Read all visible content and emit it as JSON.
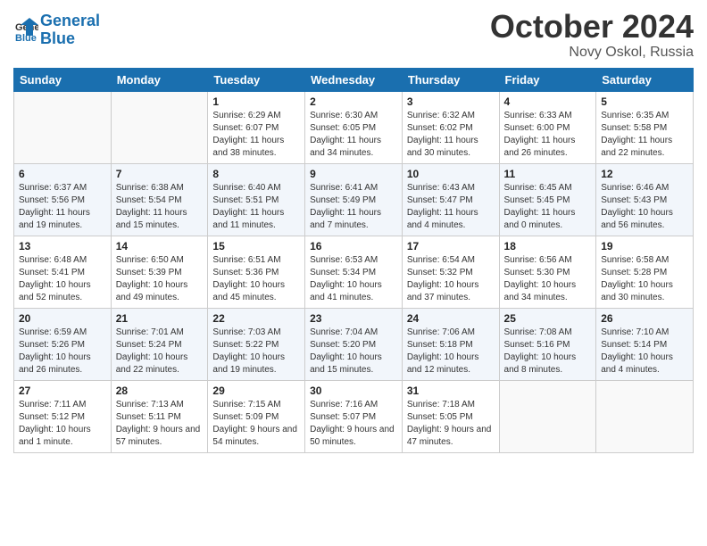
{
  "header": {
    "logo_line1": "General",
    "logo_line2": "Blue",
    "month": "October 2024",
    "location": "Novy Oskol, Russia"
  },
  "weekdays": [
    "Sunday",
    "Monday",
    "Tuesday",
    "Wednesday",
    "Thursday",
    "Friday",
    "Saturday"
  ],
  "weeks": [
    [
      {
        "day": "",
        "sunrise": "",
        "sunset": "",
        "daylight": ""
      },
      {
        "day": "",
        "sunrise": "",
        "sunset": "",
        "daylight": ""
      },
      {
        "day": "1",
        "sunrise": "Sunrise: 6:29 AM",
        "sunset": "Sunset: 6:07 PM",
        "daylight": "Daylight: 11 hours and 38 minutes."
      },
      {
        "day": "2",
        "sunrise": "Sunrise: 6:30 AM",
        "sunset": "Sunset: 6:05 PM",
        "daylight": "Daylight: 11 hours and 34 minutes."
      },
      {
        "day": "3",
        "sunrise": "Sunrise: 6:32 AM",
        "sunset": "Sunset: 6:02 PM",
        "daylight": "Daylight: 11 hours and 30 minutes."
      },
      {
        "day": "4",
        "sunrise": "Sunrise: 6:33 AM",
        "sunset": "Sunset: 6:00 PM",
        "daylight": "Daylight: 11 hours and 26 minutes."
      },
      {
        "day": "5",
        "sunrise": "Sunrise: 6:35 AM",
        "sunset": "Sunset: 5:58 PM",
        "daylight": "Daylight: 11 hours and 22 minutes."
      }
    ],
    [
      {
        "day": "6",
        "sunrise": "Sunrise: 6:37 AM",
        "sunset": "Sunset: 5:56 PM",
        "daylight": "Daylight: 11 hours and 19 minutes."
      },
      {
        "day": "7",
        "sunrise": "Sunrise: 6:38 AM",
        "sunset": "Sunset: 5:54 PM",
        "daylight": "Daylight: 11 hours and 15 minutes."
      },
      {
        "day": "8",
        "sunrise": "Sunrise: 6:40 AM",
        "sunset": "Sunset: 5:51 PM",
        "daylight": "Daylight: 11 hours and 11 minutes."
      },
      {
        "day": "9",
        "sunrise": "Sunrise: 6:41 AM",
        "sunset": "Sunset: 5:49 PM",
        "daylight": "Daylight: 11 hours and 7 minutes."
      },
      {
        "day": "10",
        "sunrise": "Sunrise: 6:43 AM",
        "sunset": "Sunset: 5:47 PM",
        "daylight": "Daylight: 11 hours and 4 minutes."
      },
      {
        "day": "11",
        "sunrise": "Sunrise: 6:45 AM",
        "sunset": "Sunset: 5:45 PM",
        "daylight": "Daylight: 11 hours and 0 minutes."
      },
      {
        "day": "12",
        "sunrise": "Sunrise: 6:46 AM",
        "sunset": "Sunset: 5:43 PM",
        "daylight": "Daylight: 10 hours and 56 minutes."
      }
    ],
    [
      {
        "day": "13",
        "sunrise": "Sunrise: 6:48 AM",
        "sunset": "Sunset: 5:41 PM",
        "daylight": "Daylight: 10 hours and 52 minutes."
      },
      {
        "day": "14",
        "sunrise": "Sunrise: 6:50 AM",
        "sunset": "Sunset: 5:39 PM",
        "daylight": "Daylight: 10 hours and 49 minutes."
      },
      {
        "day": "15",
        "sunrise": "Sunrise: 6:51 AM",
        "sunset": "Sunset: 5:36 PM",
        "daylight": "Daylight: 10 hours and 45 minutes."
      },
      {
        "day": "16",
        "sunrise": "Sunrise: 6:53 AM",
        "sunset": "Sunset: 5:34 PM",
        "daylight": "Daylight: 10 hours and 41 minutes."
      },
      {
        "day": "17",
        "sunrise": "Sunrise: 6:54 AM",
        "sunset": "Sunset: 5:32 PM",
        "daylight": "Daylight: 10 hours and 37 minutes."
      },
      {
        "day": "18",
        "sunrise": "Sunrise: 6:56 AM",
        "sunset": "Sunset: 5:30 PM",
        "daylight": "Daylight: 10 hours and 34 minutes."
      },
      {
        "day": "19",
        "sunrise": "Sunrise: 6:58 AM",
        "sunset": "Sunset: 5:28 PM",
        "daylight": "Daylight: 10 hours and 30 minutes."
      }
    ],
    [
      {
        "day": "20",
        "sunrise": "Sunrise: 6:59 AM",
        "sunset": "Sunset: 5:26 PM",
        "daylight": "Daylight: 10 hours and 26 minutes."
      },
      {
        "day": "21",
        "sunrise": "Sunrise: 7:01 AM",
        "sunset": "Sunset: 5:24 PM",
        "daylight": "Daylight: 10 hours and 22 minutes."
      },
      {
        "day": "22",
        "sunrise": "Sunrise: 7:03 AM",
        "sunset": "Sunset: 5:22 PM",
        "daylight": "Daylight: 10 hours and 19 minutes."
      },
      {
        "day": "23",
        "sunrise": "Sunrise: 7:04 AM",
        "sunset": "Sunset: 5:20 PM",
        "daylight": "Daylight: 10 hours and 15 minutes."
      },
      {
        "day": "24",
        "sunrise": "Sunrise: 7:06 AM",
        "sunset": "Sunset: 5:18 PM",
        "daylight": "Daylight: 10 hours and 12 minutes."
      },
      {
        "day": "25",
        "sunrise": "Sunrise: 7:08 AM",
        "sunset": "Sunset: 5:16 PM",
        "daylight": "Daylight: 10 hours and 8 minutes."
      },
      {
        "day": "26",
        "sunrise": "Sunrise: 7:10 AM",
        "sunset": "Sunset: 5:14 PM",
        "daylight": "Daylight: 10 hours and 4 minutes."
      }
    ],
    [
      {
        "day": "27",
        "sunrise": "Sunrise: 7:11 AM",
        "sunset": "Sunset: 5:12 PM",
        "daylight": "Daylight: 10 hours and 1 minute."
      },
      {
        "day": "28",
        "sunrise": "Sunrise: 7:13 AM",
        "sunset": "Sunset: 5:11 PM",
        "daylight": "Daylight: 9 hours and 57 minutes."
      },
      {
        "day": "29",
        "sunrise": "Sunrise: 7:15 AM",
        "sunset": "Sunset: 5:09 PM",
        "daylight": "Daylight: 9 hours and 54 minutes."
      },
      {
        "day": "30",
        "sunrise": "Sunrise: 7:16 AM",
        "sunset": "Sunset: 5:07 PM",
        "daylight": "Daylight: 9 hours and 50 minutes."
      },
      {
        "day": "31",
        "sunrise": "Sunrise: 7:18 AM",
        "sunset": "Sunset: 5:05 PM",
        "daylight": "Daylight: 9 hours and 47 minutes."
      },
      {
        "day": "",
        "sunrise": "",
        "sunset": "",
        "daylight": ""
      },
      {
        "day": "",
        "sunrise": "",
        "sunset": "",
        "daylight": ""
      }
    ]
  ]
}
